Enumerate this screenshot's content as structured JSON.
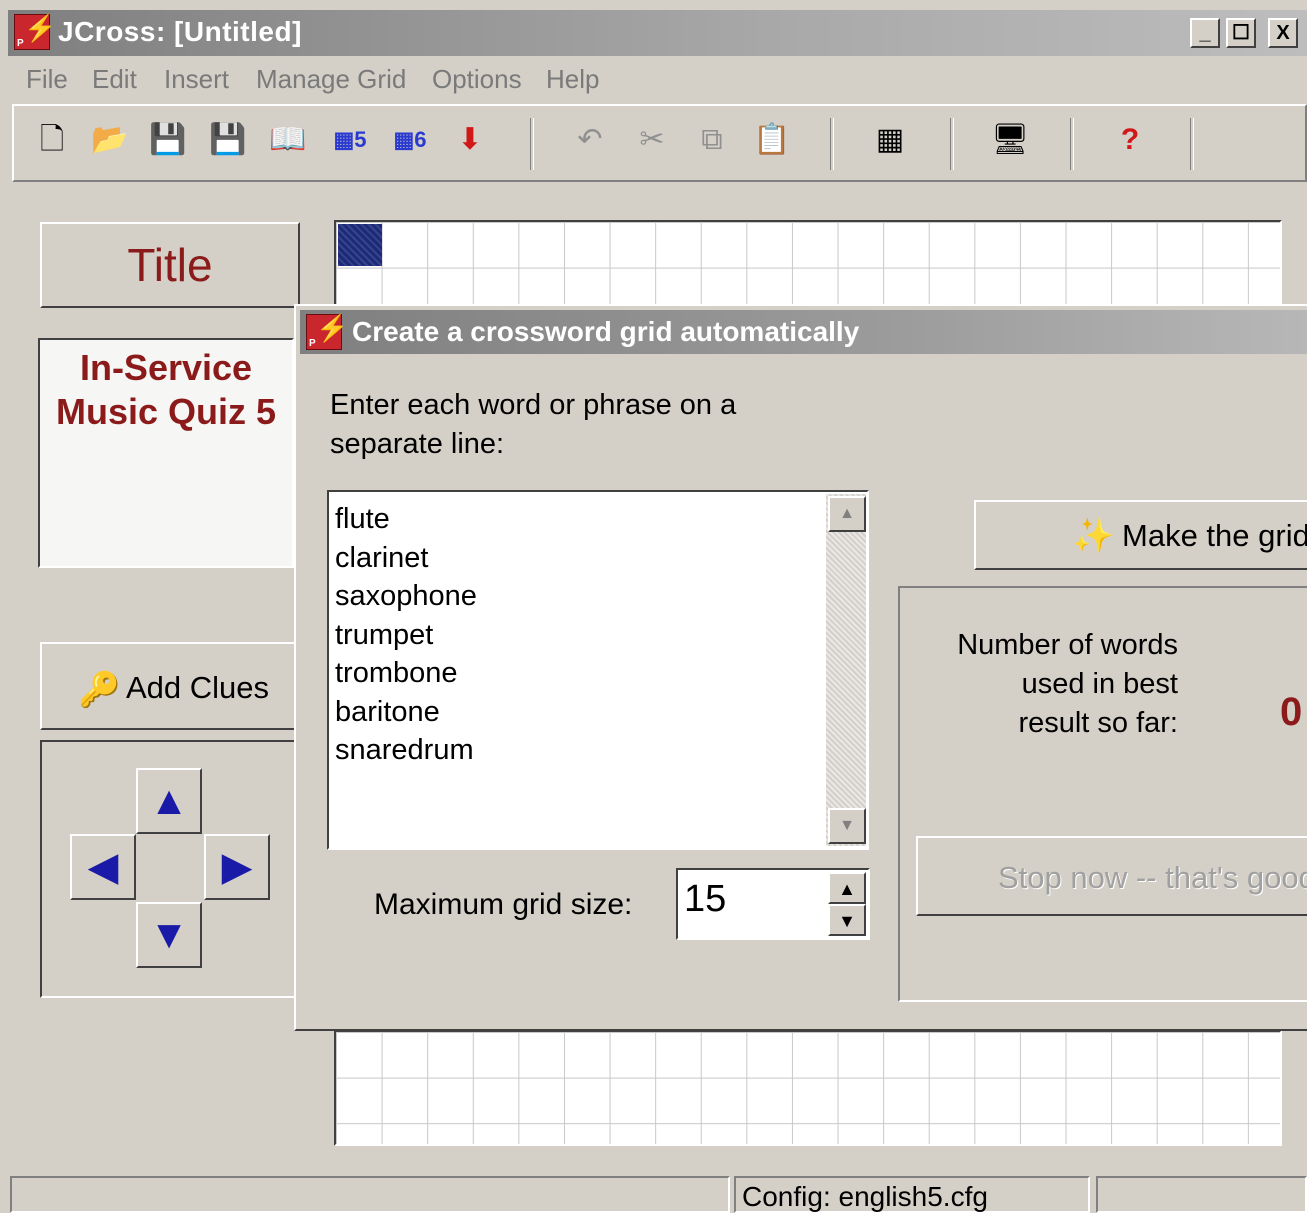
{
  "window": {
    "title": "JCross: [Untitled]",
    "controls": [
      "_",
      "☐",
      "X"
    ]
  },
  "menu": {
    "items": [
      {
        "label": "File",
        "accel": "F"
      },
      {
        "label": "Edit",
        "accel": "E"
      },
      {
        "label": "Insert",
        "accel": "I"
      },
      {
        "label": "Manage Grid",
        "accel": "M"
      },
      {
        "label": "Options",
        "accel": "O"
      },
      {
        "label": "Help",
        "accel": "H"
      }
    ]
  },
  "toolbar": {
    "icons": [
      "new-file-icon",
      "open-folder-icon",
      "save-icon",
      "save-as-icon",
      "book-icon",
      "hotpot5-web-icon",
      "hotpot6-web-icon",
      "export-down-icon",
      "undo-icon",
      "cut-icon",
      "copy-icon",
      "paste-icon",
      "auto-grid-icon",
      "screen-icon",
      "help-icon"
    ]
  },
  "left_panel": {
    "title_button": "Title",
    "quiz_title": "In-Service\nMusic Quiz 5",
    "add_clues": "Add Clues",
    "arrows": [
      "up",
      "left",
      "right",
      "down"
    ]
  },
  "dialog": {
    "title": "Create a crossword grid automatically",
    "instructions": "Enter each word or phrase on a separate line:",
    "words": [
      "flute",
      "clarinet",
      "saxophone",
      "trumpet",
      "trombone",
      "baritone",
      "snaredrum"
    ],
    "max_size_label": "Maximum grid size:",
    "max_size_value": "15",
    "make_grid_button": "Make the grid",
    "result_label": "Number of words\nused in best\nresult so far:",
    "result_value": "0",
    "stop_button": "Stop now -- that's good"
  },
  "status": {
    "config": "Config: english5.cfg"
  },
  "colors": {
    "accent_red": "#8b1a1a",
    "window_bg": "#d4d0c8",
    "selected_cell": "#1c2a7a"
  }
}
